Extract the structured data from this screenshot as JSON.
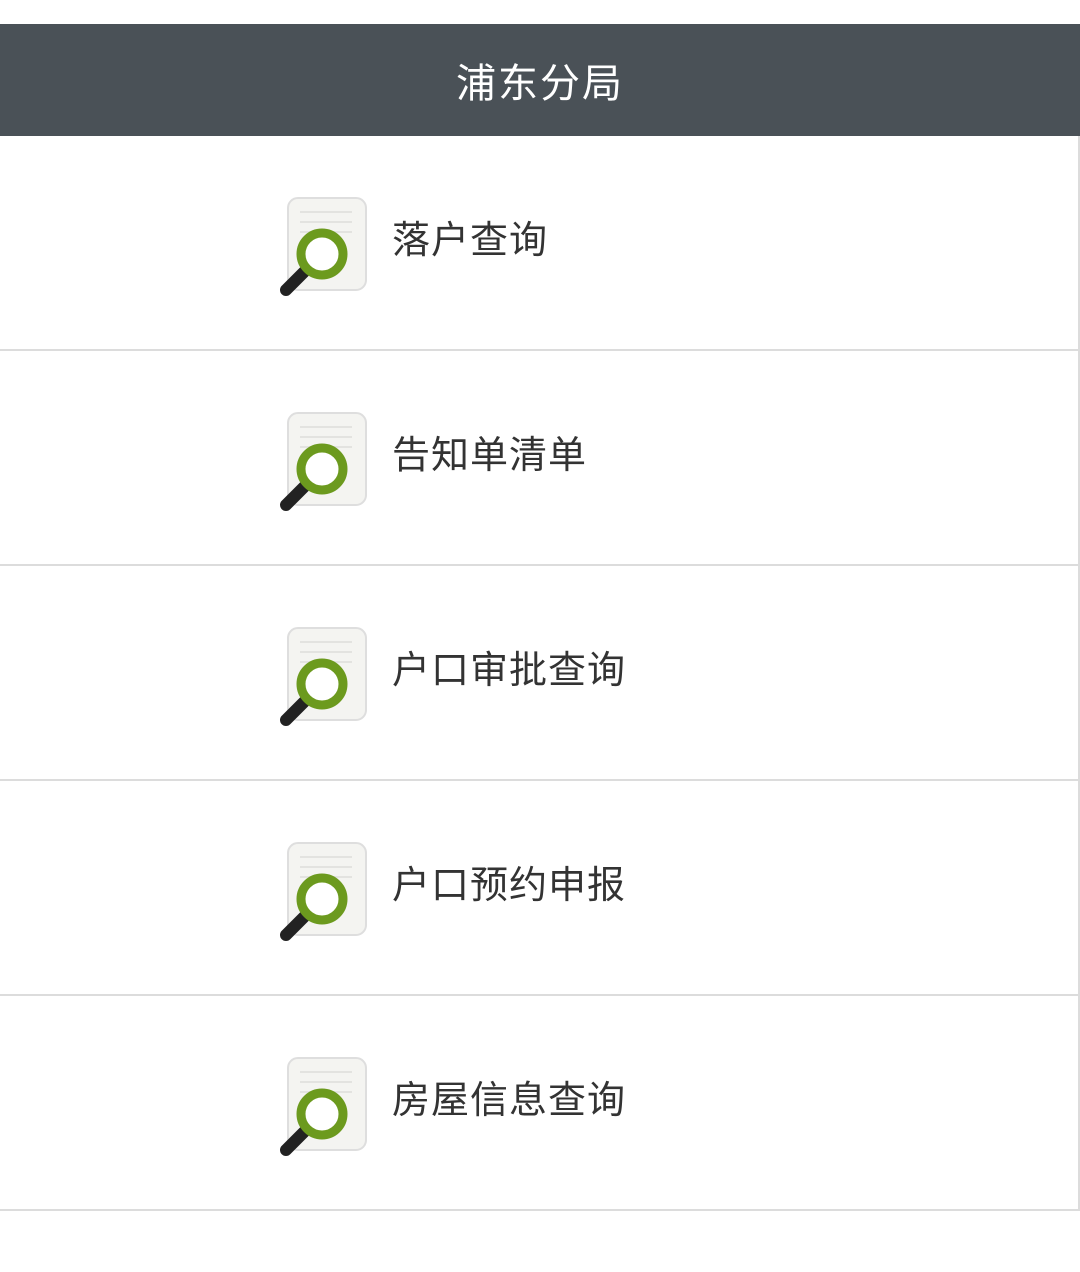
{
  "header": {
    "title": "浦东分局"
  },
  "menu": {
    "icon": "document-search-icon",
    "items": [
      {
        "label": "落户查询"
      },
      {
        "label": "告知单清单"
      },
      {
        "label": "户口审批查询"
      },
      {
        "label": "户口预约申报"
      },
      {
        "label": "房屋信息查询"
      }
    ]
  },
  "colors": {
    "header_bg": "#4a5157",
    "header_text": "#ffffff",
    "item_text": "#333333",
    "divider": "#dcdcdc",
    "icon_ring": "#6c9a1e"
  }
}
